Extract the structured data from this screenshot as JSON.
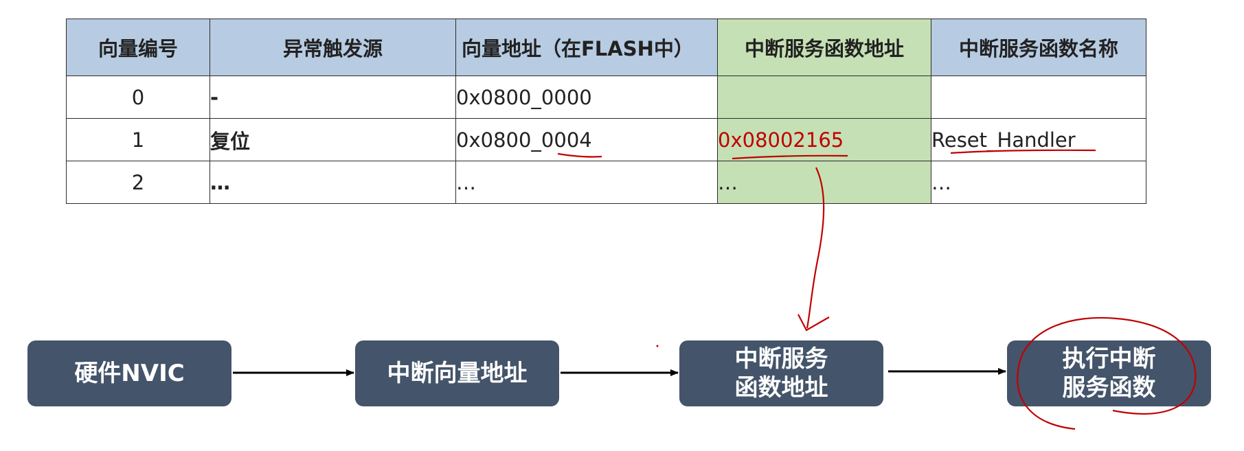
{
  "table": {
    "headers": [
      "向量编号",
      "异常触发源",
      "向量地址（在FLASH中）",
      "中断服务函数地址",
      "中断服务函数名称"
    ],
    "rows": [
      [
        "0",
        "-",
        "0x0800_0000",
        "",
        ""
      ],
      [
        "1",
        "复位",
        "0x0800_0004",
        "0x08002165",
        "Reset_Handler"
      ],
      [
        "2",
        "…",
        "…",
        "…",
        "…"
      ]
    ]
  },
  "flow": {
    "nodes": [
      {
        "lines": [
          "硬件NVIC"
        ]
      },
      {
        "lines": [
          "中断向量地址"
        ]
      },
      {
        "lines": [
          "中断服务",
          "函数地址"
        ]
      },
      {
        "lines": [
          "执行中断",
          "服务函数"
        ]
      }
    ]
  },
  "colors": {
    "header_blue": "#b7cbe2",
    "highlight_green": "#c5e0b4",
    "box_fill": "#44546a",
    "annotation_red": "#c00000"
  }
}
